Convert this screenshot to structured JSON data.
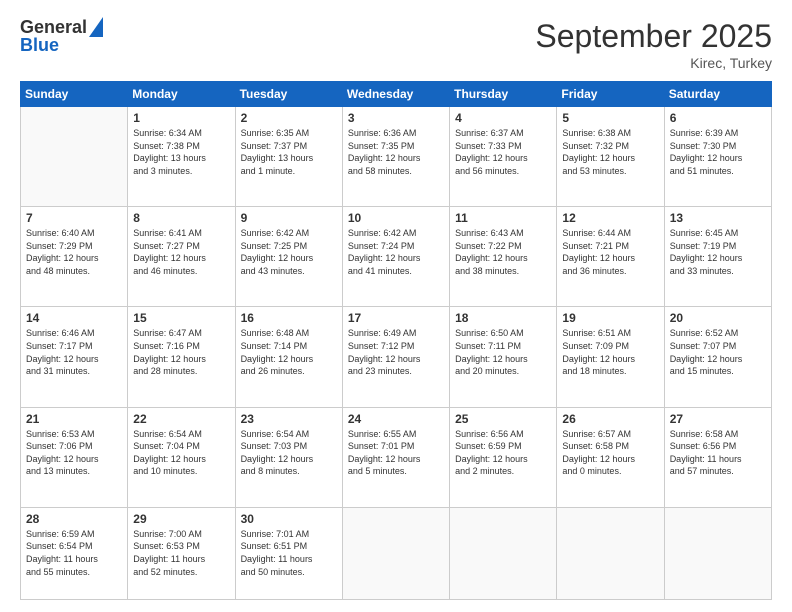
{
  "logo": {
    "general": "General",
    "blue": "Blue"
  },
  "header": {
    "month": "September 2025",
    "location": "Kirec, Turkey"
  },
  "weekdays": [
    "Sunday",
    "Monday",
    "Tuesday",
    "Wednesday",
    "Thursday",
    "Friday",
    "Saturday"
  ],
  "weeks": [
    [
      {
        "day": "",
        "lines": []
      },
      {
        "day": "1",
        "lines": [
          "Sunrise: 6:34 AM",
          "Sunset: 7:38 PM",
          "Daylight: 13 hours",
          "and 3 minutes."
        ]
      },
      {
        "day": "2",
        "lines": [
          "Sunrise: 6:35 AM",
          "Sunset: 7:37 PM",
          "Daylight: 13 hours",
          "and 1 minute."
        ]
      },
      {
        "day": "3",
        "lines": [
          "Sunrise: 6:36 AM",
          "Sunset: 7:35 PM",
          "Daylight: 12 hours",
          "and 58 minutes."
        ]
      },
      {
        "day": "4",
        "lines": [
          "Sunrise: 6:37 AM",
          "Sunset: 7:33 PM",
          "Daylight: 12 hours",
          "and 56 minutes."
        ]
      },
      {
        "day": "5",
        "lines": [
          "Sunrise: 6:38 AM",
          "Sunset: 7:32 PM",
          "Daylight: 12 hours",
          "and 53 minutes."
        ]
      },
      {
        "day": "6",
        "lines": [
          "Sunrise: 6:39 AM",
          "Sunset: 7:30 PM",
          "Daylight: 12 hours",
          "and 51 minutes."
        ]
      }
    ],
    [
      {
        "day": "7",
        "lines": [
          "Sunrise: 6:40 AM",
          "Sunset: 7:29 PM",
          "Daylight: 12 hours",
          "and 48 minutes."
        ]
      },
      {
        "day": "8",
        "lines": [
          "Sunrise: 6:41 AM",
          "Sunset: 7:27 PM",
          "Daylight: 12 hours",
          "and 46 minutes."
        ]
      },
      {
        "day": "9",
        "lines": [
          "Sunrise: 6:42 AM",
          "Sunset: 7:25 PM",
          "Daylight: 12 hours",
          "and 43 minutes."
        ]
      },
      {
        "day": "10",
        "lines": [
          "Sunrise: 6:42 AM",
          "Sunset: 7:24 PM",
          "Daylight: 12 hours",
          "and 41 minutes."
        ]
      },
      {
        "day": "11",
        "lines": [
          "Sunrise: 6:43 AM",
          "Sunset: 7:22 PM",
          "Daylight: 12 hours",
          "and 38 minutes."
        ]
      },
      {
        "day": "12",
        "lines": [
          "Sunrise: 6:44 AM",
          "Sunset: 7:21 PM",
          "Daylight: 12 hours",
          "and 36 minutes."
        ]
      },
      {
        "day": "13",
        "lines": [
          "Sunrise: 6:45 AM",
          "Sunset: 7:19 PM",
          "Daylight: 12 hours",
          "and 33 minutes."
        ]
      }
    ],
    [
      {
        "day": "14",
        "lines": [
          "Sunrise: 6:46 AM",
          "Sunset: 7:17 PM",
          "Daylight: 12 hours",
          "and 31 minutes."
        ]
      },
      {
        "day": "15",
        "lines": [
          "Sunrise: 6:47 AM",
          "Sunset: 7:16 PM",
          "Daylight: 12 hours",
          "and 28 minutes."
        ]
      },
      {
        "day": "16",
        "lines": [
          "Sunrise: 6:48 AM",
          "Sunset: 7:14 PM",
          "Daylight: 12 hours",
          "and 26 minutes."
        ]
      },
      {
        "day": "17",
        "lines": [
          "Sunrise: 6:49 AM",
          "Sunset: 7:12 PM",
          "Daylight: 12 hours",
          "and 23 minutes."
        ]
      },
      {
        "day": "18",
        "lines": [
          "Sunrise: 6:50 AM",
          "Sunset: 7:11 PM",
          "Daylight: 12 hours",
          "and 20 minutes."
        ]
      },
      {
        "day": "19",
        "lines": [
          "Sunrise: 6:51 AM",
          "Sunset: 7:09 PM",
          "Daylight: 12 hours",
          "and 18 minutes."
        ]
      },
      {
        "day": "20",
        "lines": [
          "Sunrise: 6:52 AM",
          "Sunset: 7:07 PM",
          "Daylight: 12 hours",
          "and 15 minutes."
        ]
      }
    ],
    [
      {
        "day": "21",
        "lines": [
          "Sunrise: 6:53 AM",
          "Sunset: 7:06 PM",
          "Daylight: 12 hours",
          "and 13 minutes."
        ]
      },
      {
        "day": "22",
        "lines": [
          "Sunrise: 6:54 AM",
          "Sunset: 7:04 PM",
          "Daylight: 12 hours",
          "and 10 minutes."
        ]
      },
      {
        "day": "23",
        "lines": [
          "Sunrise: 6:54 AM",
          "Sunset: 7:03 PM",
          "Daylight: 12 hours",
          "and 8 minutes."
        ]
      },
      {
        "day": "24",
        "lines": [
          "Sunrise: 6:55 AM",
          "Sunset: 7:01 PM",
          "Daylight: 12 hours",
          "and 5 minutes."
        ]
      },
      {
        "day": "25",
        "lines": [
          "Sunrise: 6:56 AM",
          "Sunset: 6:59 PM",
          "Daylight: 12 hours",
          "and 2 minutes."
        ]
      },
      {
        "day": "26",
        "lines": [
          "Sunrise: 6:57 AM",
          "Sunset: 6:58 PM",
          "Daylight: 12 hours",
          "and 0 minutes."
        ]
      },
      {
        "day": "27",
        "lines": [
          "Sunrise: 6:58 AM",
          "Sunset: 6:56 PM",
          "Daylight: 11 hours",
          "and 57 minutes."
        ]
      }
    ],
    [
      {
        "day": "28",
        "lines": [
          "Sunrise: 6:59 AM",
          "Sunset: 6:54 PM",
          "Daylight: 11 hours",
          "and 55 minutes."
        ]
      },
      {
        "day": "29",
        "lines": [
          "Sunrise: 7:00 AM",
          "Sunset: 6:53 PM",
          "Daylight: 11 hours",
          "and 52 minutes."
        ]
      },
      {
        "day": "30",
        "lines": [
          "Sunrise: 7:01 AM",
          "Sunset: 6:51 PM",
          "Daylight: 11 hours",
          "and 50 minutes."
        ]
      },
      {
        "day": "",
        "lines": []
      },
      {
        "day": "",
        "lines": []
      },
      {
        "day": "",
        "lines": []
      },
      {
        "day": "",
        "lines": []
      }
    ]
  ]
}
